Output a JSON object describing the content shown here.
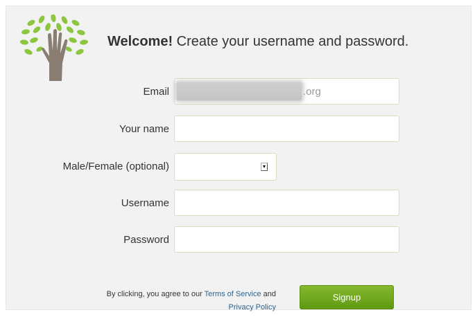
{
  "header": {
    "welcome_strong": "Welcome!",
    "welcome_rest": " Create your username and password."
  },
  "form": {
    "email": {
      "label": "Email",
      "value_suffix": ".org"
    },
    "name": {
      "label": "Your name",
      "value": ""
    },
    "gender": {
      "label": "Male/Female (optional)",
      "selected": ""
    },
    "username": {
      "label": "Username",
      "value": ""
    },
    "password": {
      "label": "Password",
      "value": ""
    }
  },
  "footer": {
    "prefix": "By clicking, you agree to our ",
    "terms_link": "Terms of Service",
    "and": " and ",
    "privacy_link": "Privacy Policy",
    "signup_label": "Signup"
  },
  "colors": {
    "accent_green": "#6da61e",
    "link_blue": "#2a6496",
    "logo_hand": "#8a7e72"
  },
  "icons": {
    "logo": "tree-hand-logo-icon",
    "select_arrow": "dropdown-arrow-icon"
  }
}
